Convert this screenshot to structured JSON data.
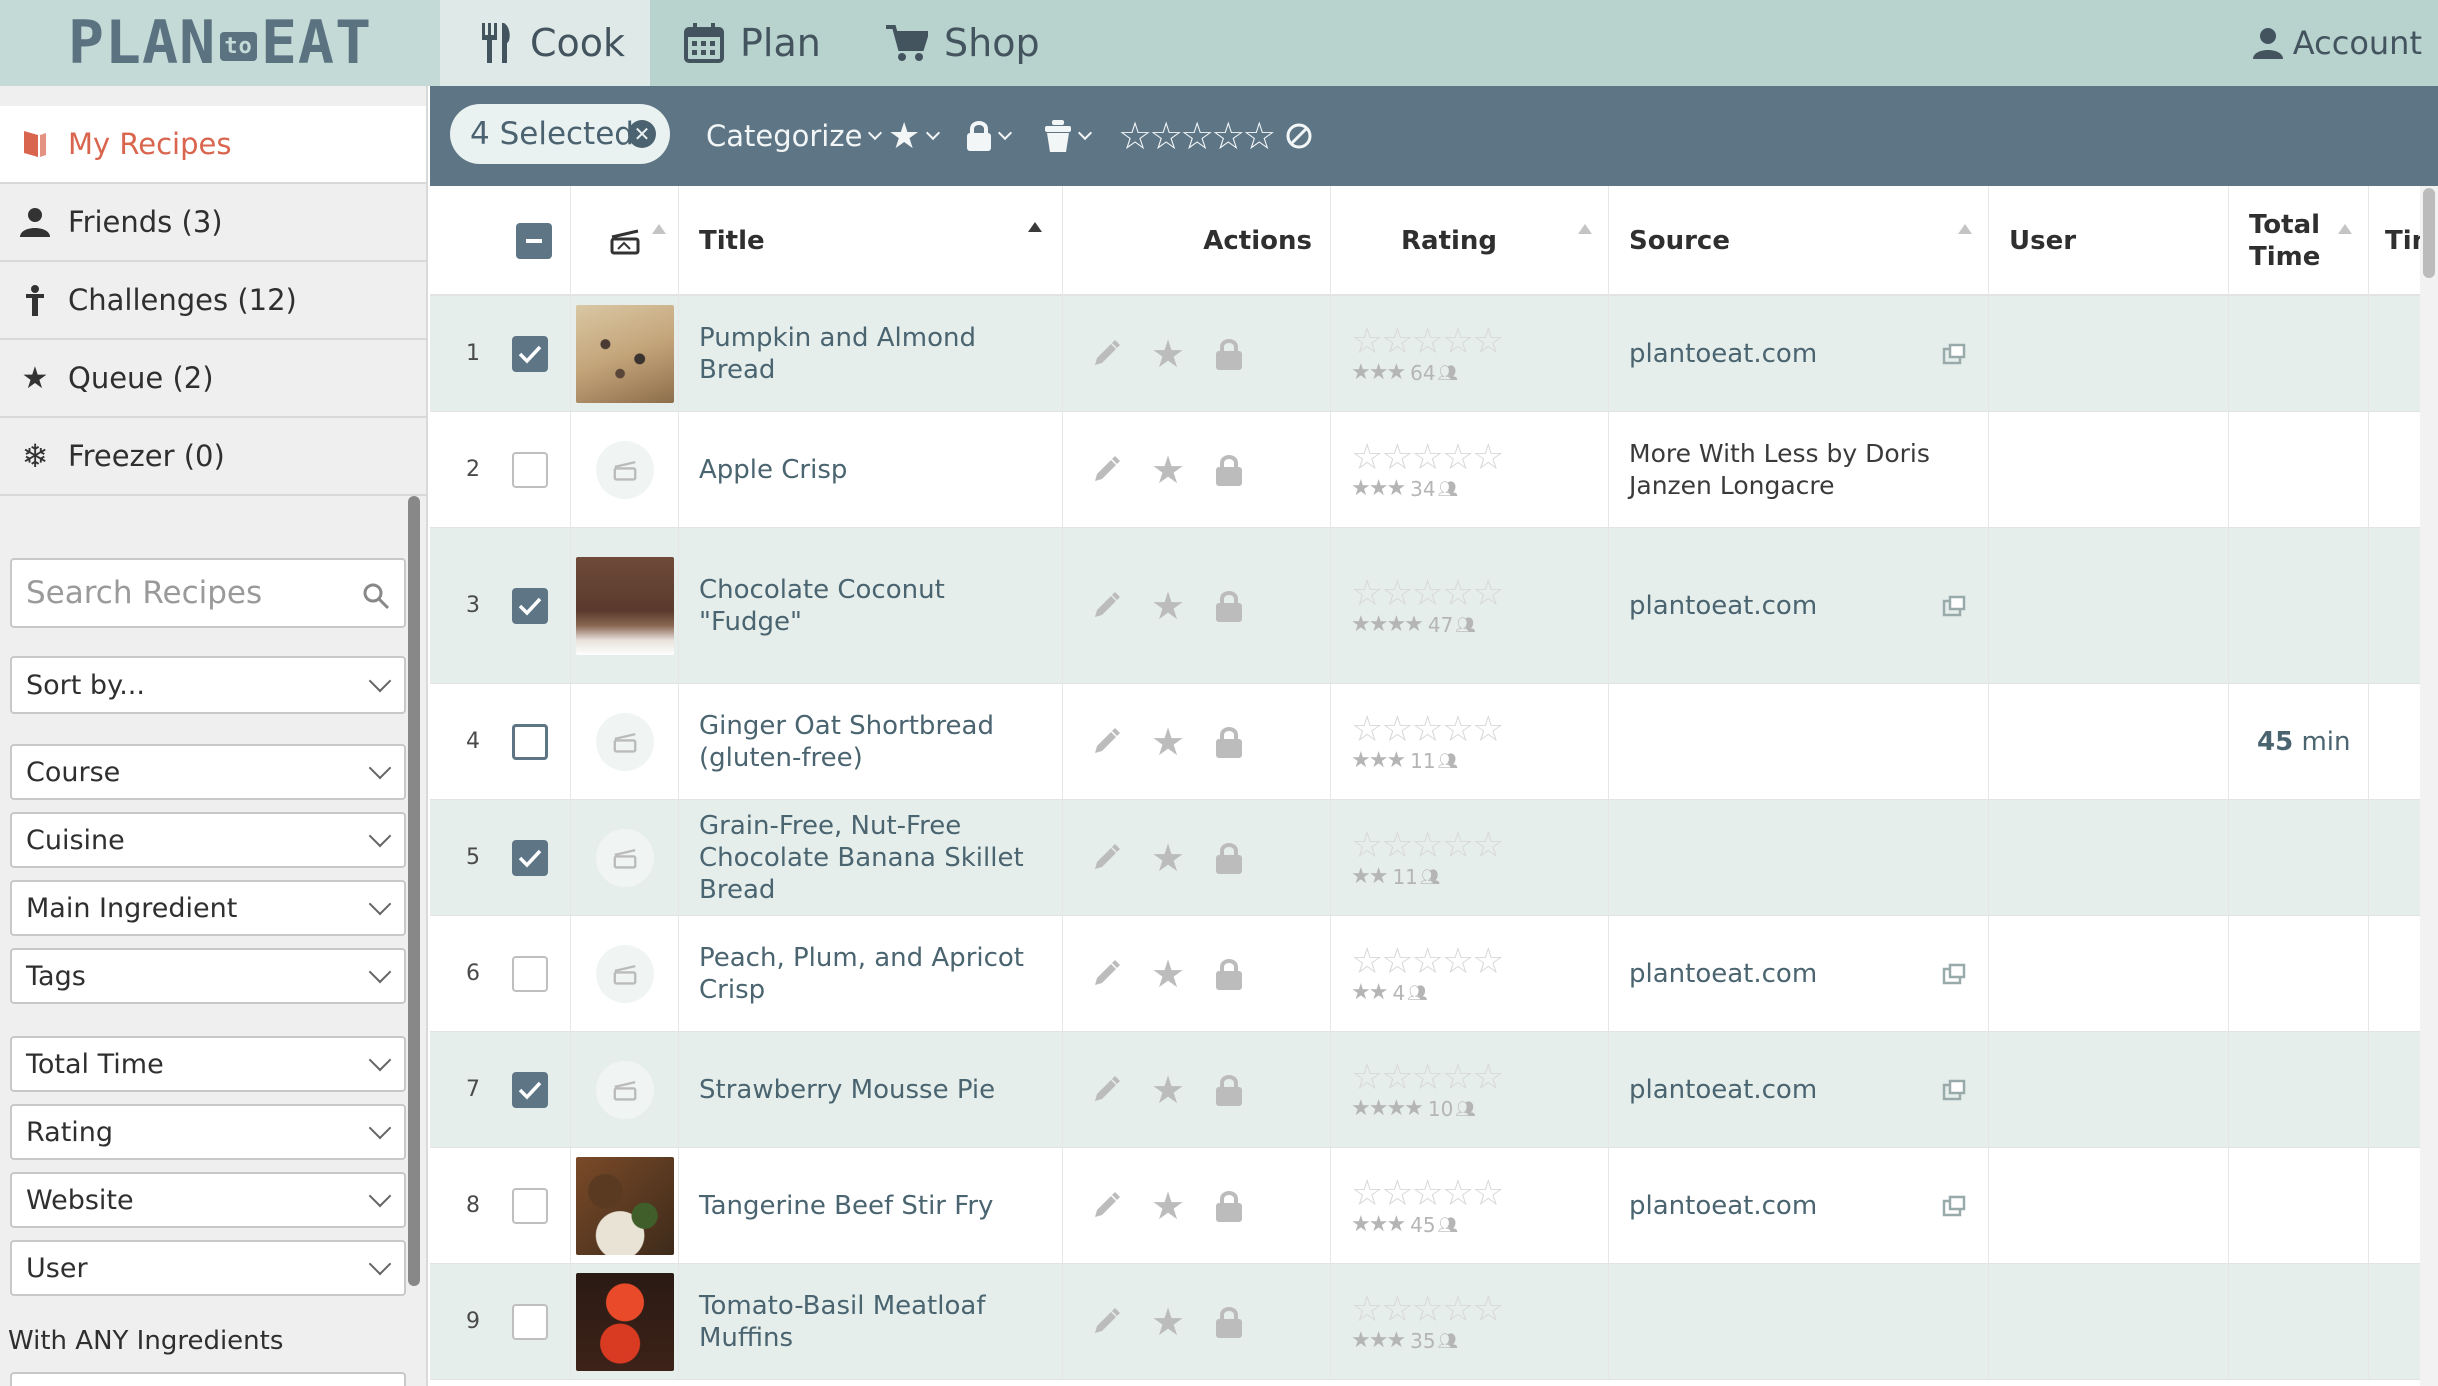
{
  "nav": {
    "logo": "PLAN",
    "logo_to": "to",
    "logo_eat": "EAT",
    "tabs": [
      {
        "label": "Cook",
        "icon": "fork-knife-icon",
        "active": true
      },
      {
        "label": "Plan",
        "icon": "calendar-icon",
        "active": false
      },
      {
        "label": "Shop",
        "icon": "cart-icon",
        "active": false
      }
    ],
    "account": "Account"
  },
  "sidebar": {
    "items": [
      {
        "label": "My Recipes",
        "icon": "recipe-book-icon",
        "active": true
      },
      {
        "label": "Friends (3)",
        "icon": "person-icon"
      },
      {
        "label": "Challenges (12)",
        "icon": "challenge-icon"
      },
      {
        "label": "Queue (2)",
        "icon": "star-icon"
      },
      {
        "label": "Freezer (0)",
        "icon": "snowflake-icon"
      }
    ],
    "search_placeholder": "Search Recipes",
    "sort_label": "Sort by...",
    "filters_a": [
      "Course",
      "Cuisine",
      "Main Ingredient",
      "Tags"
    ],
    "filters_b": [
      "Total Time",
      "Rating",
      "Website",
      "User"
    ],
    "ingredients_label": "With ANY Ingredients"
  },
  "toolbar": {
    "selected": "4 Selected",
    "categorize": "Categorize"
  },
  "table": {
    "headers": {
      "title": "Title",
      "actions": "Actions",
      "rating": "Rating",
      "source": "Source",
      "user": "User",
      "total_time_1": "Total",
      "total_time_2": "Time",
      "extra": "Tim"
    },
    "rows": [
      {
        "num": "1",
        "checked": true,
        "title": "Pumpkin and Almond Bread",
        "has_photo": true,
        "photo": "bread",
        "avg_stars": 3,
        "count": "64",
        "source": "plantoeat.com",
        "source_link": true,
        "time": ""
      },
      {
        "num": "2",
        "checked": false,
        "title": "Apple Crisp",
        "has_photo": false,
        "avg_stars": 3,
        "count": "34",
        "source": "More With Less by Doris Janzen Longacre",
        "source_link": false,
        "time": ""
      },
      {
        "num": "3",
        "checked": true,
        "title": "Chocolate Coconut \"Fudge\"",
        "has_photo": true,
        "photo": "fudge",
        "avg_stars": 4,
        "count": "47",
        "source": "plantoeat.com",
        "source_link": true,
        "time": ""
      },
      {
        "num": "4",
        "checked": false,
        "title": "Ginger Oat Shortbread (gluten-free)",
        "has_photo": false,
        "avg_stars": 3,
        "count": "11",
        "source": "",
        "source_link": false,
        "time_num": "45",
        "time_unit": "min"
      },
      {
        "num": "5",
        "checked": true,
        "title": "Grain-Free, Nut-Free Chocolate Banana Skillet Bread",
        "has_photo": false,
        "avg_stars": 2,
        "count": "11",
        "source": "",
        "source_link": false,
        "time": ""
      },
      {
        "num": "6",
        "checked": false,
        "title": "Peach, Plum, and Apricot Crisp",
        "has_photo": false,
        "avg_stars": 2,
        "count": "4",
        "source": "plantoeat.com",
        "source_link": true,
        "time": ""
      },
      {
        "num": "7",
        "checked": true,
        "title": "Strawberry Mousse Pie",
        "has_photo": false,
        "avg_stars": 4,
        "count": "10",
        "source": "plantoeat.com",
        "source_link": true,
        "time": ""
      },
      {
        "num": "8",
        "checked": false,
        "title": "Tangerine Beef Stir Fry",
        "has_photo": true,
        "photo": "beef",
        "avg_stars": 3,
        "count": "45",
        "source": "plantoeat.com",
        "source_link": true,
        "time": ""
      },
      {
        "num": "9",
        "checked": false,
        "title": "Tomato-Basil Meatloaf Muffins",
        "has_photo": true,
        "photo": "tomato",
        "avg_stars": 3,
        "count": "35",
        "source": "",
        "source_link": false,
        "time": ""
      }
    ]
  },
  "colors": {
    "accent": "#d9654e",
    "toolbar": "#5d7585",
    "nav": "#b8d2ce",
    "row_alt": "#e6eeec",
    "link": "#4a6470"
  }
}
